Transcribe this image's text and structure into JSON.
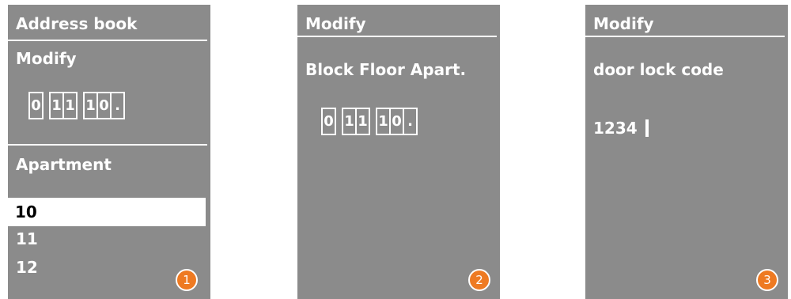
{
  "screens": [
    {
      "title": "Address book",
      "subtitle": "Modify",
      "code_cells": [
        "0",
        "1",
        "1",
        "1",
        "0",
        "."
      ],
      "section_label": "Apartment",
      "list": {
        "items": [
          "10",
          "11",
          "12"
        ],
        "selected": "10"
      },
      "step_badge": "1"
    },
    {
      "title": "Modify",
      "field_label": "Block Floor Apart.",
      "code_cells": [
        "0",
        "1",
        "1",
        "1",
        "0",
        "."
      ],
      "step_badge": "2"
    },
    {
      "title": "Modify",
      "field_label": "door lock code",
      "value": "1234",
      "step_badge": "3"
    }
  ],
  "colors": {
    "screen_background": "#8b8b8b",
    "text": "#ffffff",
    "selection_background": "#ffffff",
    "selection_text": "#000000",
    "badge": "#ee7a22"
  },
  "icons": {
    "cursor": "text-cursor-icon",
    "badge": "step-number-badge"
  }
}
